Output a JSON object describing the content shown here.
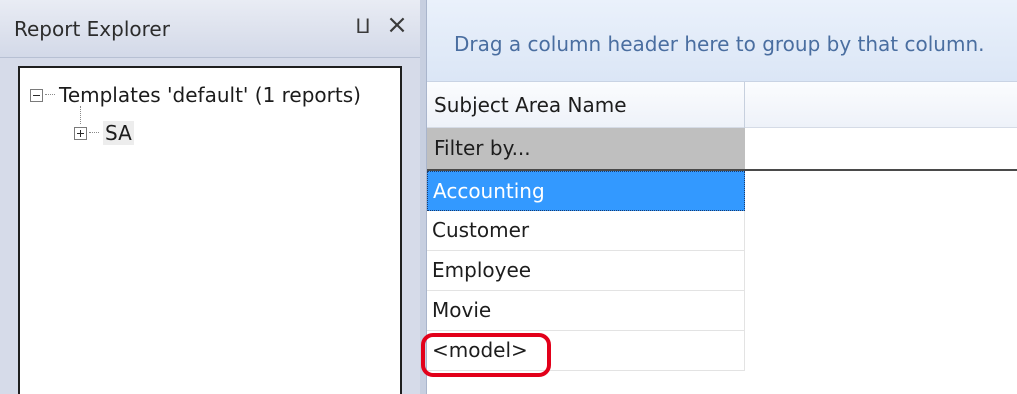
{
  "explorer": {
    "title": "Report Explorer",
    "pin_glyph": "⨿",
    "close_glyph": "×",
    "tree": {
      "root_label": "Templates 'default' (1 reports)",
      "child_label": "SA"
    }
  },
  "grid": {
    "group_hint": "Drag a column header here to group by that column.",
    "column_header": "Subject Area Name",
    "filter_placeholder": "Filter by...",
    "rows": [
      {
        "label": "Accounting"
      },
      {
        "label": "Customer"
      },
      {
        "label": "Employee"
      },
      {
        "label": "Movie"
      },
      {
        "label": "<model>"
      }
    ],
    "selected_row": "Accounting"
  },
  "colors": {
    "selection": "#3399ff",
    "annotation": "#e2001a",
    "group_hint_text": "#4a6ea0"
  },
  "icons": [
    "pin-icon",
    "close-icon",
    "collapse-icon",
    "expand-icon"
  ]
}
